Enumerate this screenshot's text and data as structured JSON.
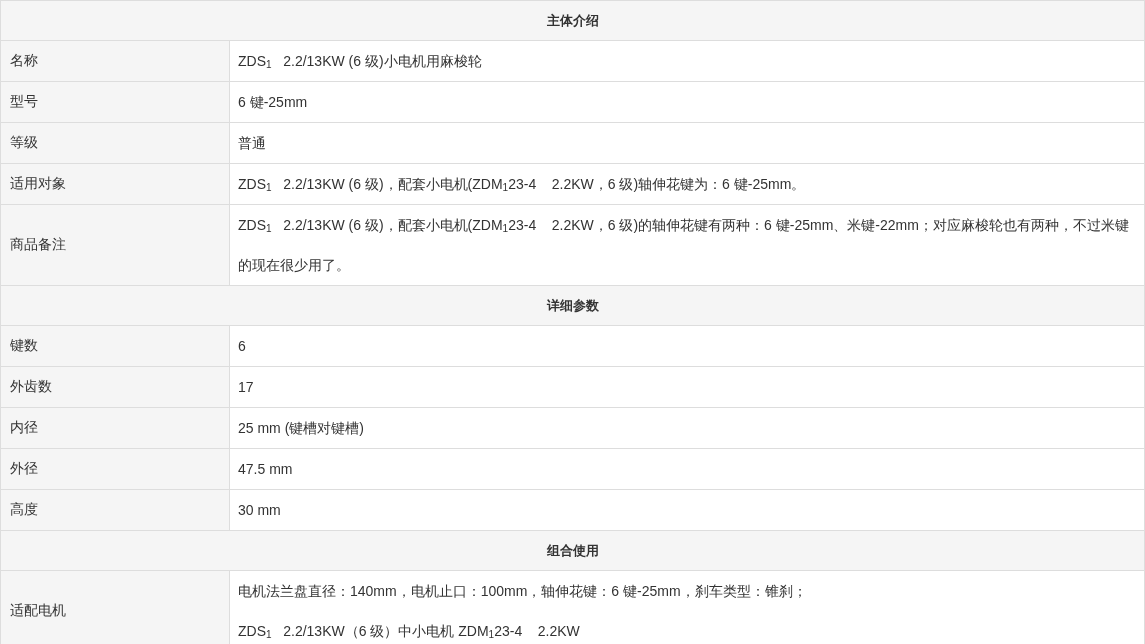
{
  "sections": [
    {
      "title": "主体介绍",
      "rows": [
        {
          "label": "名称",
          "lines": [
            "ZDS$_{1}$   2.2/13KW (6 级)小电机用麻梭轮"
          ]
        },
        {
          "label": "型号",
          "lines": [
            "6 键-25mm"
          ]
        },
        {
          "label": "等级",
          "lines": [
            "普通"
          ]
        },
        {
          "label": "适用对象",
          "lines": [
            "ZDS$_{1}$   2.2/13KW (6 级)，配套小电机(ZDM$_{1}$23-4    2.2KW，6 级)轴伸花键为：6 键-25mm。"
          ]
        },
        {
          "label": "商品备注",
          "lines": [
            "ZDS$_{1}$   2.2/13KW (6 级)，配套小电机(ZDM$_{1}$23-4    2.2KW，6 级)的轴伸花键有两种：6 键-25mm、米键-22mm；对应麻梭轮也有两种，不过米键的现在很少用了。"
          ]
        }
      ]
    },
    {
      "title": "详细参数",
      "rows": [
        {
          "label": "键数",
          "lines": [
            "6"
          ]
        },
        {
          "label": "外齿数",
          "lines": [
            "17"
          ]
        },
        {
          "label": "内径",
          "lines": [
            "25 mm (键槽对键槽)"
          ]
        },
        {
          "label": "外径",
          "lines": [
            "47.5 mm"
          ]
        },
        {
          "label": "高度",
          "lines": [
            "30 mm"
          ]
        }
      ]
    },
    {
      "title": "组合使用",
      "rows": [
        {
          "label": "适配电机",
          "lines": [
            "电机法兰盘直径：140mm，电机止口：100mm，轴伸花键：6 键-25mm，刹车类型：锥刹；",
            "ZDS$_{1}$   2.2/13KW（6 级）中小电机 ZDM$_{1}$23-4    2.2KW"
          ]
        }
      ]
    }
  ]
}
